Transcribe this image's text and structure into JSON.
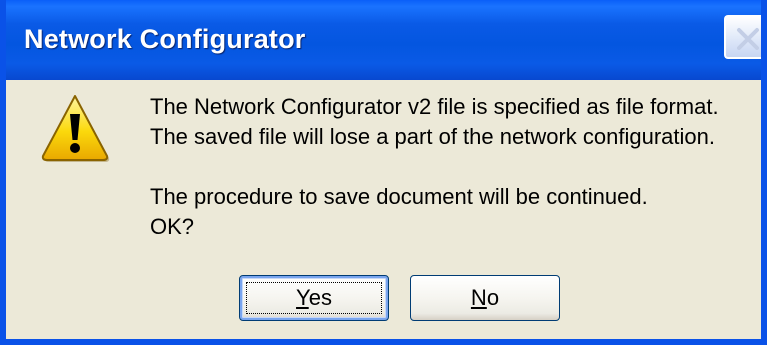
{
  "window": {
    "title": "Network Configurator",
    "close_icon": "close-icon",
    "accent_color": "#0a52e8",
    "face_color": "#ece9d8"
  },
  "dialog": {
    "icon": "warning-icon",
    "message_lines": [
      "The Network Configurator v2 file is specified as file format.",
      "The saved file will lose a part of the network configuration.",
      "The procedure to save document will be continued.",
      "OK?"
    ]
  },
  "buttons": {
    "yes": {
      "mnemonic": "Y",
      "rest": "es"
    },
    "no": {
      "mnemonic": "N",
      "rest": "o"
    }
  }
}
